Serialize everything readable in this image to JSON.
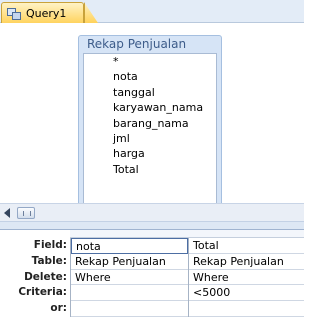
{
  "tab": {
    "label": "Query1",
    "icon": "query-design-icon"
  },
  "table_box": {
    "title": "Rekap Penjualan",
    "fields": [
      "*",
      "nota",
      "tanggal",
      "karyawan_nama",
      "barang_nama",
      "jml",
      "harga",
      "Total"
    ]
  },
  "grid": {
    "row_labels": [
      "Field:",
      "Table:",
      "Delete:",
      "Criteria:",
      "or:"
    ],
    "columns": [
      {
        "field": "nota",
        "table": "Rekap Penjualan",
        "delete": "Where",
        "criteria": "",
        "or": ""
      },
      {
        "field": "Total",
        "table": "Rekap Penjualan",
        "delete": "Where",
        "criteria": "<5000",
        "or": ""
      }
    ]
  },
  "colors": {
    "tab_active": "#ffd25a",
    "tab_strip": "#e3ecf7",
    "table_header": "#d6e4f6",
    "table_title_text": "#3d5c8a"
  }
}
